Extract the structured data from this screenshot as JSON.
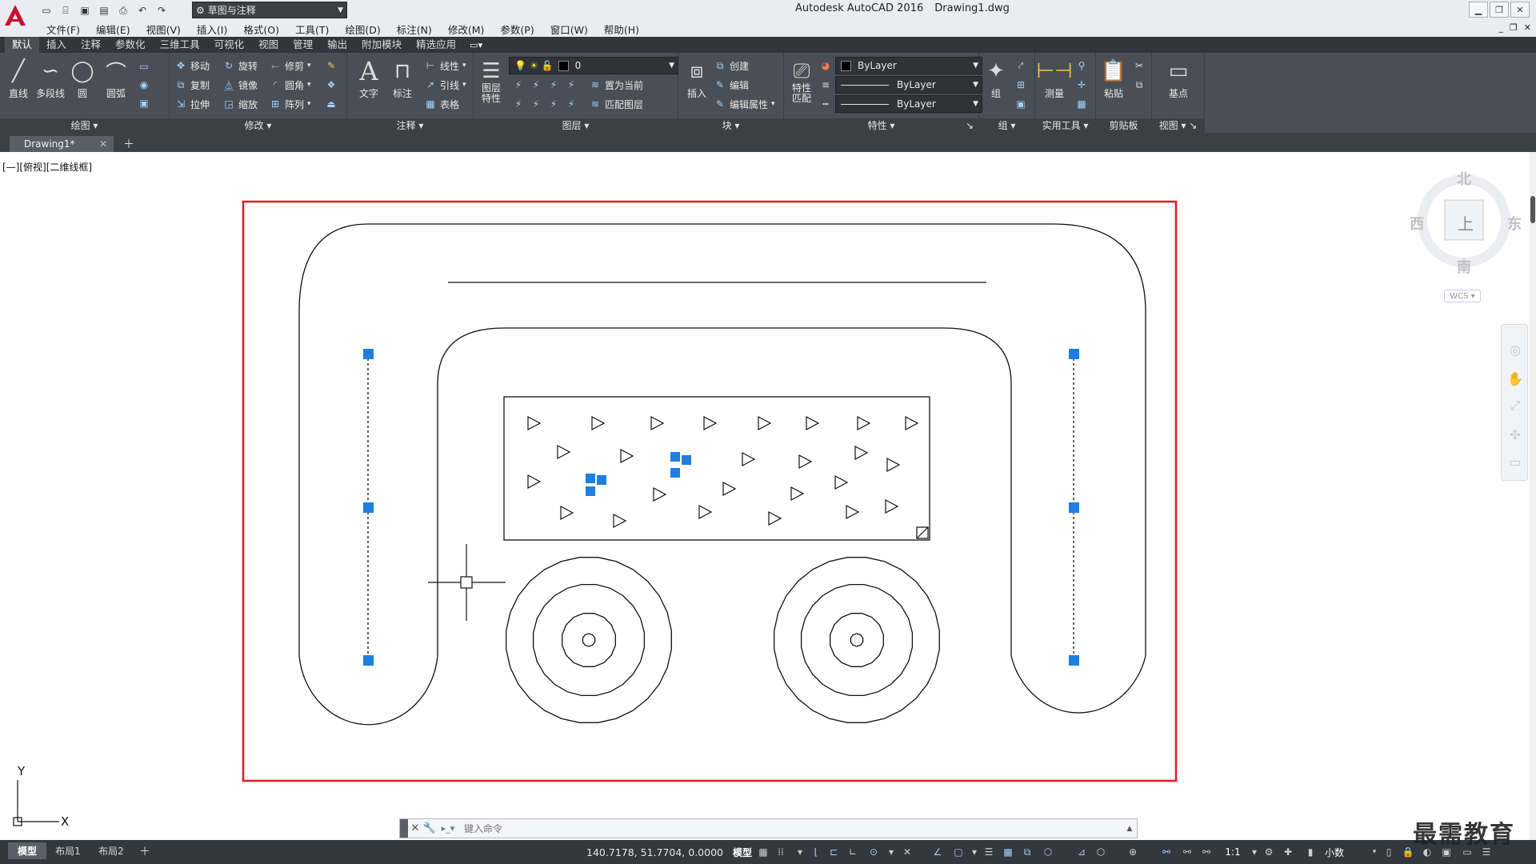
{
  "app": {
    "logo_letter": "A",
    "title": "Autodesk AutoCAD 2016",
    "document": "Drawing1.dwg",
    "workspace": "草图与注释"
  },
  "menu": [
    "文件(F)",
    "编辑(E)",
    "视图(V)",
    "插入(I)",
    "格式(O)",
    "工具(T)",
    "绘图(D)",
    "标注(N)",
    "修改(M)",
    "参数(P)",
    "窗口(W)",
    "帮助(H)"
  ],
  "ribbon_tabs": [
    {
      "label": "默认",
      "active": true
    },
    {
      "label": "插入"
    },
    {
      "label": "注释"
    },
    {
      "label": "参数化"
    },
    {
      "label": "三维工具"
    },
    {
      "label": "可视化"
    },
    {
      "label": "视图"
    },
    {
      "label": "管理"
    },
    {
      "label": "输出"
    },
    {
      "label": "附加模块"
    },
    {
      "label": "精选应用"
    }
  ],
  "ribbon": {
    "draw": {
      "title": "绘图",
      "line": "直线",
      "polyline": "多段线",
      "circle": "圆",
      "arc": "圆弧"
    },
    "modify": {
      "title": "修改",
      "move": "移动",
      "rotate": "旋转",
      "trim": "修剪",
      "copy": "复制",
      "mirror": "镜像",
      "fillet": "圆角",
      "stretch": "拉伸",
      "scale": "缩放",
      "array": "阵列"
    },
    "annotation": {
      "title": "注释",
      "text": "文字",
      "dimension": "标注",
      "linear": "线性",
      "leader": "引线",
      "table": "表格"
    },
    "layers": {
      "title": "图层",
      "properties": "图层\n特性",
      "layer_value": "0",
      "set_current": "置为当前",
      "match_layer": "匹配图层"
    },
    "block": {
      "title": "块",
      "insert": "插入",
      "create": "创建",
      "edit": "编辑",
      "edit_attr": "编辑属性"
    },
    "properties": {
      "title": "特性",
      "match": "特性\n匹配",
      "color": "ByLayer",
      "linetype": "ByLayer",
      "lineweight": "ByLayer"
    },
    "groups": {
      "title": "组",
      "group": "组"
    },
    "utilities": {
      "title": "实用工具",
      "measure": "测量"
    },
    "clipboard": {
      "title": "剪贴板",
      "paste": "粘贴"
    },
    "view": {
      "title": "视图",
      "base": "基点"
    }
  },
  "doc_tab": {
    "label": "Drawing1*"
  },
  "viewport_label": "[—][俯视][二维线框]",
  "viewcube": {
    "north": "北",
    "south": "南",
    "east": "东",
    "west": "西",
    "top_face": "上",
    "wcs": "WCS"
  },
  "ucs": {
    "x": "X",
    "y": "Y"
  },
  "command": {
    "placeholder": "键入命令"
  },
  "layout_tabs": [
    {
      "label": "模型",
      "active": true
    },
    {
      "label": "布局1"
    },
    {
      "label": "布局2"
    }
  ],
  "status": {
    "coordinates": "140.7178, 51.7704, 0.0000",
    "model": "模型",
    "scale": "1:1",
    "units": "小数"
  },
  "watermark": "最需教育",
  "colors": {
    "selection_grip": "#1e7fe0",
    "frame_highlight": "#e11c1c",
    "ribbon_bg": "#4a4f57"
  }
}
